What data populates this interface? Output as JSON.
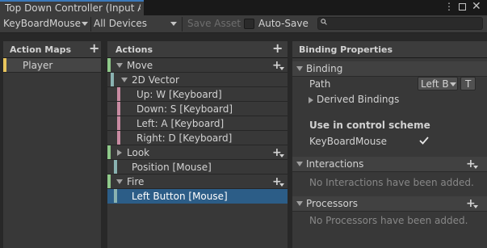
{
  "window": {
    "tab_title": "Top Down Controller (Input Actions)",
    "menu_icon": "ellipsis-vertical-icon",
    "maximize_icon": "maximize-icon",
    "close_icon": "close-icon"
  },
  "toolbar": {
    "control_scheme": "KeyBoardMouse",
    "devices": "All Devices",
    "save_asset_label": "Save Asset",
    "auto_save_label": "Auto-Save",
    "auto_save_checked": false,
    "search_placeholder": "",
    "search_icon": "search-icon"
  },
  "action_maps": {
    "header": "Action Maps",
    "items": [
      {
        "label": "Player",
        "color": "#e8c55d"
      }
    ]
  },
  "actions": {
    "header": "Actions",
    "rows": [
      {
        "label": "Move",
        "type": "action",
        "color": "#8fc98a"
      },
      {
        "label": "2D Vector",
        "type": "composite",
        "color": "#8ab2b1"
      },
      {
        "label": "Up: W [Keyboard]",
        "type": "part",
        "color": "#c98ba2"
      },
      {
        "label": "Down: S [Keyboard]",
        "type": "part",
        "color": "#c98ba2"
      },
      {
        "label": "Left: A [Keyboard]",
        "type": "part",
        "color": "#c98ba2"
      },
      {
        "label": "Right: D [Keyboard]",
        "type": "part",
        "color": "#c98ba2"
      },
      {
        "label": "Look",
        "type": "action",
        "color": "#8fc98a"
      },
      {
        "label": "Position [Mouse]",
        "type": "binding",
        "color": "#8ab2b1"
      },
      {
        "label": "Fire",
        "type": "action",
        "color": "#8fc98a"
      },
      {
        "label": "Left Button [Mouse]",
        "type": "binding",
        "color": "#8ab2b1",
        "selected": true
      }
    ],
    "selected_color": "#2c5d87"
  },
  "binding_properties": {
    "header": "Binding Properties",
    "binding_section": "Binding",
    "path_label": "Path",
    "path_value": "Left B",
    "path_t_button": "T",
    "derived_bindings": "Derived Bindings",
    "use_in_scheme": "Use in control scheme",
    "scheme_name": "KeyBoardMouse",
    "scheme_checked": true,
    "interactions_section": "Interactions",
    "interactions_empty": "No Interactions have been added.",
    "processors_section": "Processors",
    "processors_empty": "No Processors have been added."
  }
}
